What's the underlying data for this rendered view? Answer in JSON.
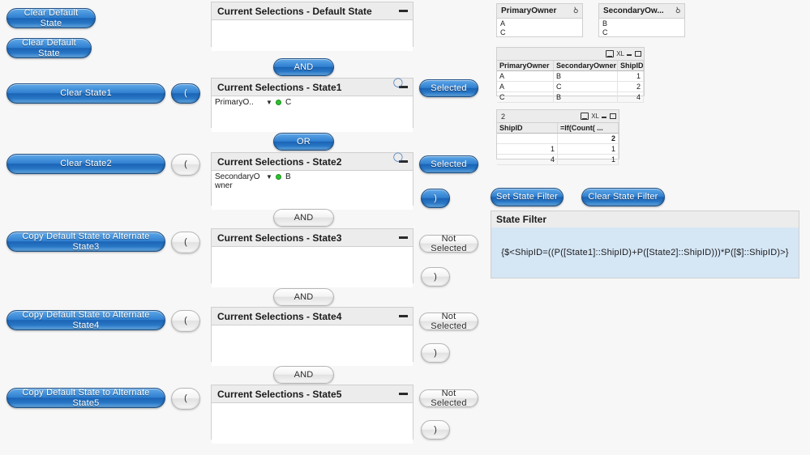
{
  "left_buttons": [
    {
      "label": "Clear Default State",
      "style": "blue"
    },
    {
      "label": "Clear  Default State",
      "style": "blue"
    },
    {
      "label": "Clear  State1",
      "style": "blue"
    },
    {
      "label": "Clear  State2",
      "style": "blue"
    },
    {
      "label": "Copy  Default State to Alternate State3",
      "style": "blue"
    },
    {
      "label": "Copy  Default State to Alternate State4",
      "style": "blue"
    },
    {
      "label": "Copy  Default State to Alternate State5",
      "style": "blue"
    }
  ],
  "paren_open_buttons": [
    {
      "label": "(",
      "style": "blue"
    },
    {
      "label": "(",
      "style": "gray"
    },
    {
      "label": "(",
      "style": "gray"
    },
    {
      "label": "(",
      "style": "gray"
    },
    {
      "label": "(",
      "style": "gray"
    }
  ],
  "operators": [
    {
      "label": "AND",
      "style": "blue"
    },
    {
      "label": "OR",
      "style": "blue"
    },
    {
      "label": "AND",
      "style": "gray"
    },
    {
      "label": "AND",
      "style": "gray"
    },
    {
      "label": "AND",
      "style": "gray"
    }
  ],
  "selection_panels": [
    {
      "title": "Current Selections - Default State",
      "rows": []
    },
    {
      "title": "Current Selections - State1",
      "rows": [
        {
          "field": "PrimaryO..",
          "value": "C"
        }
      ]
    },
    {
      "title": "Current Selections - State2",
      "rows": [
        {
          "field": "SecondaryOwner",
          "value": "B"
        }
      ]
    },
    {
      "title": "Current Selections - State3",
      "rows": []
    },
    {
      "title": "Current Selections - State4",
      "rows": []
    },
    {
      "title": "Current Selections - State5",
      "rows": []
    }
  ],
  "mode_buttons": [
    {
      "label": "Selected",
      "style": "blue"
    },
    {
      "label": "Selected",
      "style": "blue"
    },
    {
      "label": "Not Selected",
      "style": "gray"
    },
    {
      "label": "Not Selected",
      "style": "gray"
    },
    {
      "label": "Not Selected",
      "style": "gray"
    }
  ],
  "paren_close_buttons": [
    {
      "label": ")",
      "style": "blue"
    },
    {
      "label": ")",
      "style": "gray"
    },
    {
      "label": ")",
      "style": "gray"
    },
    {
      "label": ")",
      "style": "gray"
    }
  ],
  "listboxes": [
    {
      "title": "PrimaryOwner",
      "search_icon": "search-icon",
      "items": [
        "A",
        "C"
      ]
    },
    {
      "title": "SecondaryOw...",
      "search_icon": "search-icon",
      "items": [
        "B",
        "C"
      ]
    }
  ],
  "table_one": {
    "caption": "",
    "icons": [
      "print-icon",
      "excel-export-icon",
      "minimize-icon",
      "maximize-icon"
    ],
    "excel_label": "XL",
    "columns": [
      "PrimaryOwner",
      "SecondaryOwner",
      "ShipID"
    ],
    "rows": [
      [
        "A",
        "B",
        "1"
      ],
      [
        "A",
        "C",
        "2"
      ],
      [
        "C",
        "B",
        "4"
      ]
    ]
  },
  "table_two": {
    "caption": "2",
    "icons": [
      "print-icon",
      "excel-export-icon",
      "minimize-icon",
      "maximize-icon"
    ],
    "excel_label": "XL",
    "columns": [
      "ShipID",
      "=If(Count( ..."
    ],
    "total_row": [
      "",
      "2"
    ],
    "rows": [
      [
        "1",
        "1"
      ],
      [
        "4",
        "1"
      ]
    ]
  },
  "filter_buttons": [
    {
      "label": "Set State Filter",
      "style": "blue"
    },
    {
      "label": "Clear State Filter",
      "style": "blue"
    }
  ],
  "state_filter": {
    "title": "State Filter",
    "expression": "{$<ShipID=((P([State1]::ShipID)+P([State2]::ShipID)))*P([$]::ShipID)>}"
  },
  "colors": {
    "accent_blue": "#2f7fd0",
    "panel_header": "#ececec",
    "page_bg": "#f7f7f7",
    "text_obj_bg": "#d5e6f5",
    "selected_dot": "#2ec22e"
  }
}
